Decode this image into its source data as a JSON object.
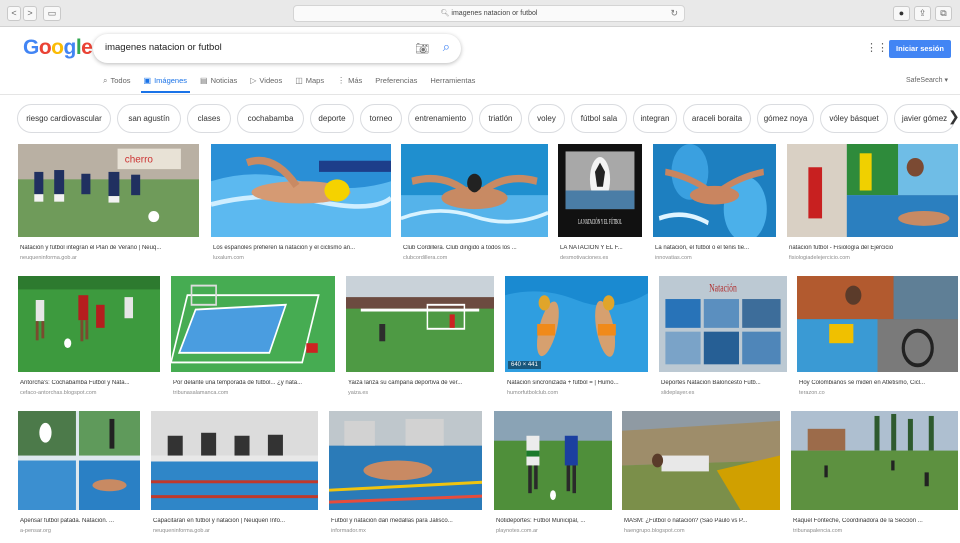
{
  "browser": {
    "url": "imagenes natacion or futbol",
    "back": "<",
    "forward": ">"
  },
  "google": {
    "logo": "Google",
    "query": "imagenes natacion or futbol",
    "signin": "Iniciar sesión",
    "safesearch": "SafeSearch ▾"
  },
  "tabs": [
    {
      "label": "Todos",
      "icon": "search-icon",
      "glyph": "⌕"
    },
    {
      "label": "Imágenes",
      "icon": "image-icon",
      "glyph": "▣"
    },
    {
      "label": "Noticias",
      "icon": "news-icon",
      "glyph": "▤"
    },
    {
      "label": "Videos",
      "icon": "video-icon",
      "glyph": "▷"
    },
    {
      "label": "Maps",
      "icon": "map-icon",
      "glyph": "◫"
    },
    {
      "label": "Más",
      "icon": "more-icon",
      "glyph": "⋮"
    },
    {
      "label": "Preferencias",
      "icon": "",
      "glyph": ""
    },
    {
      "label": "Herramientas",
      "icon": "",
      "glyph": ""
    }
  ],
  "chips": [
    "riesgo cardiovascular",
    "san agustín",
    "clases",
    "cochabamba",
    "deporte",
    "torneo",
    "entrenamiento",
    "triatlón",
    "voley",
    "fútbol sala",
    "integran",
    "araceli boraita",
    "gómez noya",
    "vóley básquet",
    "javier gómez"
  ],
  "results": [
    {
      "caption": "Natación y fútbol integran el Plan de Verano | Neuq...",
      "source": "neuqueninforma.gob.ar",
      "scene": "soccer-kids"
    },
    {
      "caption": "Los españoles prefieren la natación y el ciclismo an...",
      "source": "luxalum.com",
      "scene": "swim-crawl"
    },
    {
      "caption": "Club Cordillera. Club dirigido a todos los ...",
      "source": "clubcordillera.com",
      "scene": "swim-butterfly"
    },
    {
      "caption": "LA NATACIÓN Y EL F...",
      "source": "desmotivaciones.es",
      "scene": "poster-ball"
    },
    {
      "caption": "La natación, el fútbol o el tenis tie...",
      "source": "innovatias.com",
      "scene": "swim-top"
    },
    {
      "caption": "natacion futbol - Fisiología del Ejercicio",
      "source": "fisiologiadelejercicio.com",
      "scene": "collage-sports"
    },
    {
      "caption": "Antorcha's: Cochabamba Futbol y Nata...",
      "source": "cefaco-antorchas.blogspot.com",
      "scene": "soccer-red"
    },
    {
      "caption": "Por delante una temporada de fútbol... ¿y nata...",
      "source": "tribunasalamanca.com",
      "scene": "pitch-pool"
    },
    {
      "caption": "Yaiza lanza su campaña deportiva de ver...",
      "source": "yaiza.es",
      "scene": "soccer-field"
    },
    {
      "caption": "Natación sincronizada + fútbol = | Humo...",
      "source": "humorfutbolclub.com",
      "scene": "sync-swim",
      "dim": "640 × 441"
    },
    {
      "caption": "Deportes Natación Baloncesto Futb...",
      "source": "slideplayer.es",
      "scene": "slide",
      "title": "Natación"
    },
    {
      "caption": "Hoy Colombianos se miden en Atletismo, Cicl...",
      "source": "terazon.co",
      "scene": "collage-athletes"
    },
    {
      "caption": "Apensar futbol patada. Natación. ...",
      "source": "a-pensar.org",
      "scene": "collage-small"
    },
    {
      "caption": "Capacitarán en fútbol y natación | Neuquén Info...",
      "source": "neuqueninforma.gob.ar",
      "scene": "pool-start"
    },
    {
      "caption": "Futbol y natación dan medallas para Jalisco...",
      "source": "informador.mx",
      "scene": "pool-race"
    },
    {
      "caption": "Notideportes: Fútbol Municipal, ...",
      "source": "playnotes.com.ar",
      "scene": "soccer-duel"
    },
    {
      "caption": "MASM: ¿Fútbol o natación? (São Paulo vs P...",
      "source": "haengrupo.blogspot.com",
      "scene": "stadium-dive"
    },
    {
      "caption": "Raquel Fonteche, Coordinadora de la Sección ...",
      "source": "tribunapalencia.com",
      "scene": "park-field"
    }
  ]
}
